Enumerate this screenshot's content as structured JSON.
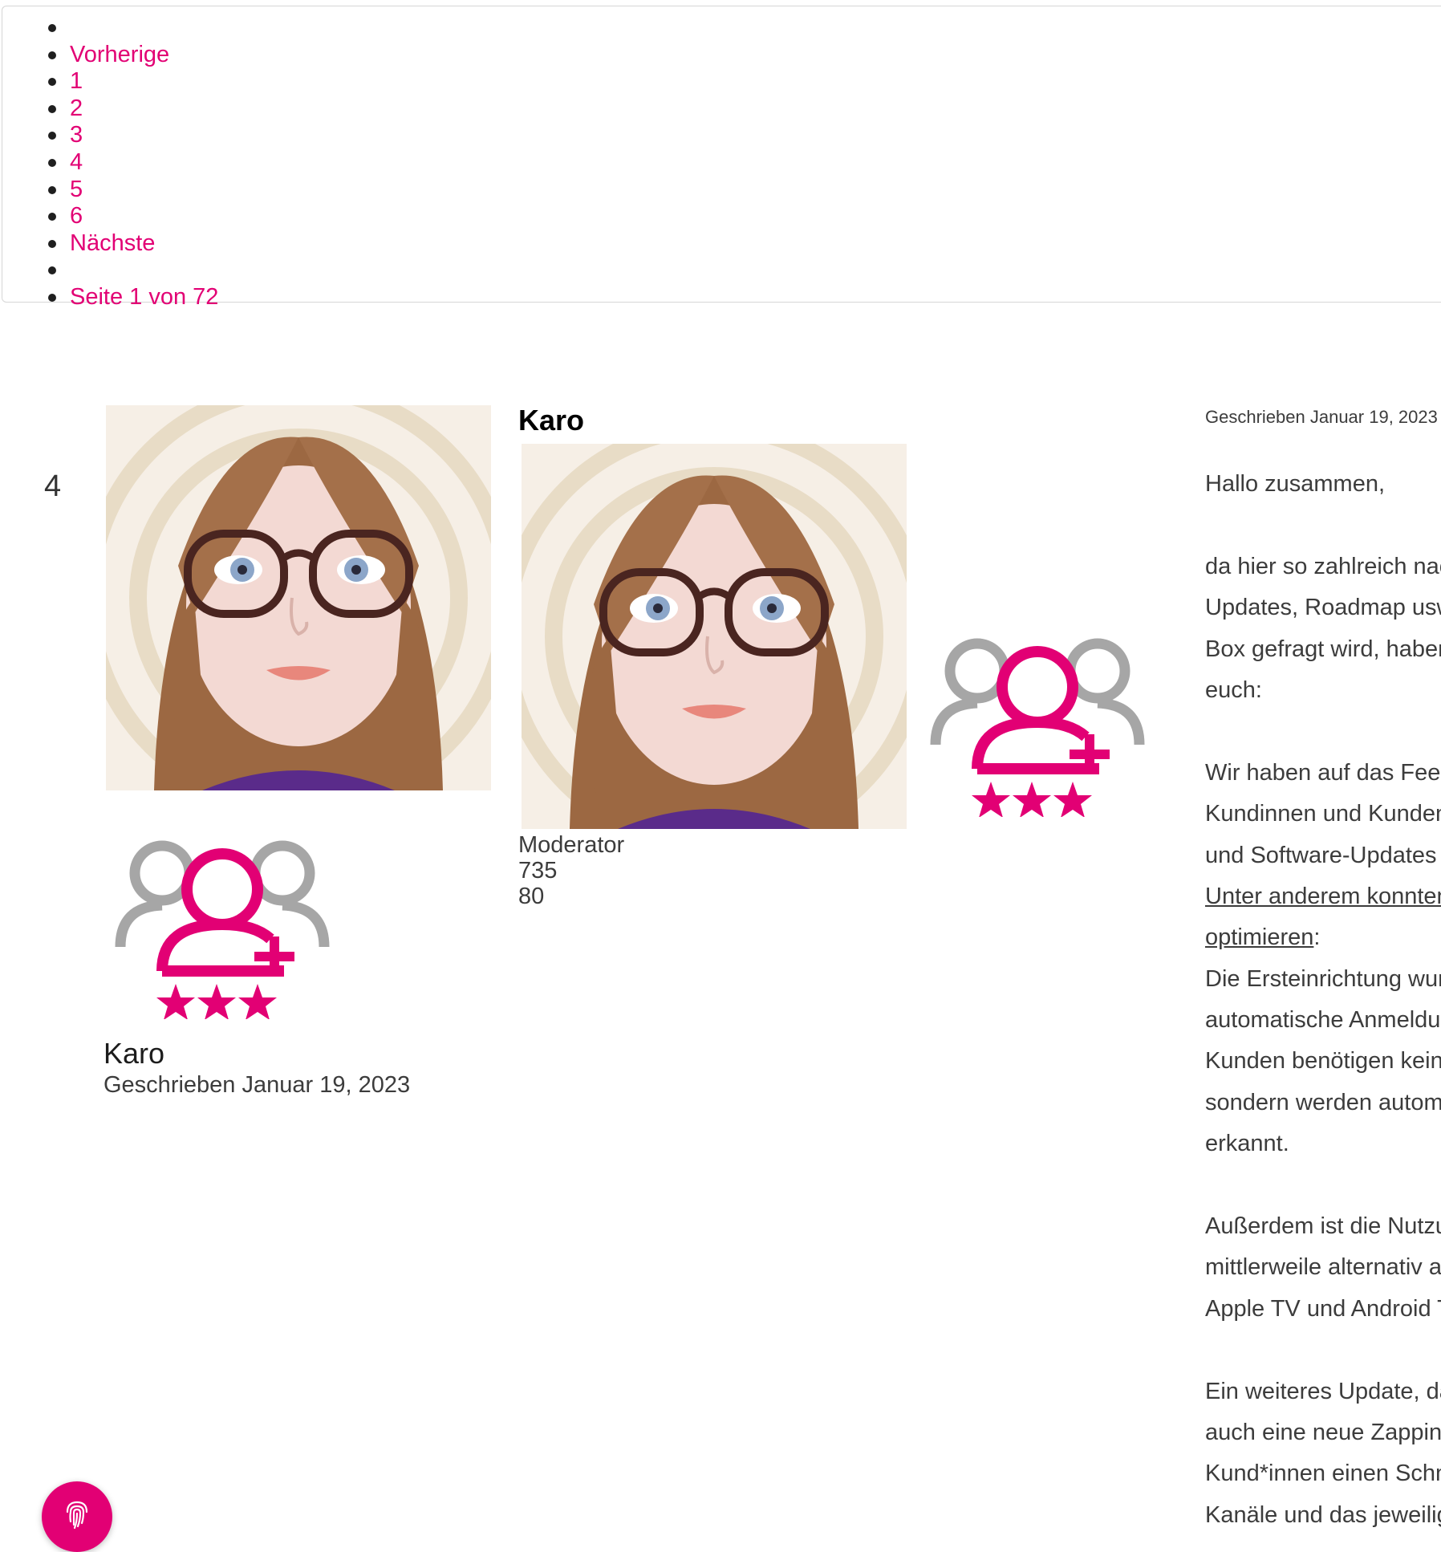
{
  "pagination": {
    "prev_label": "Vorherige",
    "pages": [
      "1",
      "2",
      "3",
      "4",
      "5",
      "6"
    ],
    "next_label": "Nächste",
    "page_info": "Seite 1 von 72"
  },
  "post": {
    "number": "4",
    "author": "Karo",
    "posted_left": "Geschrieben Januar 19, 2023",
    "posted_right": "Geschrieben Januar 19, 2023",
    "role": "Moderator",
    "stat_1": "735",
    "stat_2": "80",
    "rank_icon": "community-member-three-stars-icon",
    "body_lines": [
      "Hallo zusammen,",
      "",
      "da hier so zahlreich nac",
      "Updates, Roadmap usw",
      "Box gefragt wird, haben",
      "euch:",
      "",
      "Wir haben auf das Feed",
      "Kundinnen und Kunden",
      "und Software-Updates a",
      "Unter anderem konnten",
      "optimieren:",
      "Die Ersteinrichtung wur",
      "automatische Anmeldun",
      "Kunden benötigen keine",
      "sondern werden automa",
      "erkannt.",
      "",
      "Außerdem ist die Nutzu",
      "mittlerweile alternativ au",
      "Apple TV und Android T",
      "",
      "Ein weiteres Update, da",
      "auch eine neue Zapping",
      "Kund*innen einen Schn",
      "Kanäle und das jeweilig"
    ],
    "body_link_text": "Unter anderem konnten",
    "body_link_text_2": "optimieren"
  },
  "colors": {
    "accent": "#e20074",
    "rank_gray": "#a6a6a6",
    "text": "#3c3c3c"
  },
  "fab": {
    "icon": "fingerprint-icon"
  }
}
